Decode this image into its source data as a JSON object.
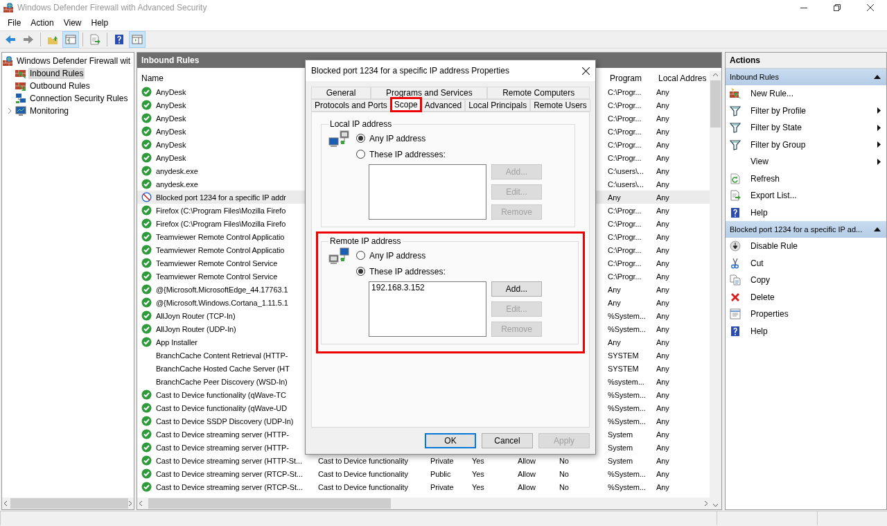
{
  "window": {
    "title": "Windows Defender Firewall with Advanced Security"
  },
  "menu": [
    "File",
    "Action",
    "View",
    "Help"
  ],
  "toolbar": [
    {
      "kind": "back",
      "pressed": false
    },
    {
      "kind": "forward",
      "pressed": false
    },
    {
      "kind": "separator"
    },
    {
      "kind": "up",
      "pressed": false
    },
    {
      "kind": "tree",
      "pressed": true
    },
    {
      "kind": "separator"
    },
    {
      "kind": "export",
      "pressed": false
    },
    {
      "kind": "separator"
    },
    {
      "kind": "help",
      "pressed": false
    },
    {
      "kind": "actionpane",
      "pressed": true
    }
  ],
  "tree": [
    {
      "label": "Windows Defender Firewall wit",
      "kind": "firewall",
      "selected": false,
      "children": [
        {
          "label": "Inbound Rules",
          "kind": "inbound",
          "selected": true
        },
        {
          "label": "Outbound Rules",
          "kind": "outbound",
          "selected": false
        },
        {
          "label": "Connection Security Rules",
          "kind": "connsec",
          "selected": false
        },
        {
          "label": "Monitoring",
          "kind": "monitor",
          "selected": false,
          "expanded": false
        }
      ]
    }
  ],
  "rules_pane": {
    "title": "Inbound Rules",
    "columns": {
      "name": "Name",
      "program": "Program",
      "local_address": "Local Addres"
    },
    "rows": [
      {
        "kind": "allow",
        "selected": false,
        "name": "AnyDesk",
        "program": "C:\\Progr...",
        "local_address": "Any"
      },
      {
        "kind": "allow",
        "selected": false,
        "name": "AnyDesk",
        "program": "C:\\Progr...",
        "local_address": "Any"
      },
      {
        "kind": "allow",
        "selected": false,
        "name": "AnyDesk",
        "program": "C:\\Progr...",
        "local_address": "Any"
      },
      {
        "kind": "allow",
        "selected": false,
        "name": "AnyDesk",
        "program": "C:\\Progr...",
        "local_address": "Any"
      },
      {
        "kind": "allow",
        "selected": false,
        "name": "AnyDesk",
        "program": "C:\\Progr...",
        "local_address": "Any"
      },
      {
        "kind": "allow",
        "selected": false,
        "name": "AnyDesk",
        "program": "C:\\Progr...",
        "local_address": "Any"
      },
      {
        "kind": "allow",
        "selected": false,
        "name": "anydesk.exe",
        "program": "C:\\users\\...",
        "local_address": "Any"
      },
      {
        "kind": "allow",
        "selected": false,
        "name": "anydesk.exe",
        "program": "C:\\users\\...",
        "local_address": "Any"
      },
      {
        "kind": "block",
        "selected": true,
        "name": "Blocked port 1234 for a specific IP addr",
        "program": "Any",
        "local_address": "Any"
      },
      {
        "kind": "allow",
        "selected": false,
        "name": "Firefox (C:\\Program Files\\Mozilla Firefo",
        "program": "C:\\Progr...",
        "local_address": "Any"
      },
      {
        "kind": "allow",
        "selected": false,
        "name": "Firefox (C:\\Program Files\\Mozilla Firefo",
        "program": "C:\\Progr...",
        "local_address": "Any"
      },
      {
        "kind": "allow",
        "selected": false,
        "name": "Teamviewer Remote Control Applicatio",
        "program": "C:\\Progr...",
        "local_address": "Any"
      },
      {
        "kind": "allow",
        "selected": false,
        "name": "Teamviewer Remote Control Applicatio",
        "program": "C:\\Progr...",
        "local_address": "Any"
      },
      {
        "kind": "allow",
        "selected": false,
        "name": "Teamviewer Remote Control Service",
        "program": "C:\\Progr...",
        "local_address": "Any"
      },
      {
        "kind": "allow",
        "selected": false,
        "name": "Teamviewer Remote Control Service",
        "program": "C:\\Progr...",
        "local_address": "Any"
      },
      {
        "kind": "allow",
        "selected": false,
        "name": "@{Microsoft.MicrosoftEdge_44.17763.1",
        "program": "Any",
        "local_address": "Any"
      },
      {
        "kind": "allow",
        "selected": false,
        "name": "@{Microsoft.Windows.Cortana_1.11.5.1",
        "program": "Any",
        "local_address": "Any"
      },
      {
        "kind": "allow",
        "selected": false,
        "name": "AllJoyn Router (TCP-In)",
        "program": "%System...",
        "local_address": "Any"
      },
      {
        "kind": "allow",
        "selected": false,
        "name": "AllJoyn Router (UDP-In)",
        "program": "%System...",
        "local_address": "Any"
      },
      {
        "kind": "allow",
        "selected": false,
        "name": "App Installer",
        "program": "Any",
        "local_address": "Any"
      },
      {
        "kind": "disabled",
        "selected": false,
        "name": "BranchCache Content Retrieval (HTTP-",
        "program": "SYSTEM",
        "local_address": "Any"
      },
      {
        "kind": "disabled",
        "selected": false,
        "name": "BranchCache Hosted Cache Server (HT",
        "program": "SYSTEM",
        "local_address": "Any"
      },
      {
        "kind": "disabled",
        "selected": false,
        "name": "BranchCache Peer Discovery (WSD-In)",
        "program": "%system...",
        "local_address": "Any"
      },
      {
        "kind": "allow",
        "selected": false,
        "name": "Cast to Device functionality (qWave-TC",
        "program": "%System...",
        "local_address": "Any"
      },
      {
        "kind": "allow",
        "selected": false,
        "name": "Cast to Device functionality (qWave-UD",
        "program": "%System...",
        "local_address": "Any"
      },
      {
        "kind": "allow",
        "selected": false,
        "name": "Cast to Device SSDP Discovery (UDP-In)",
        "program": "%System...",
        "local_address": "Any"
      },
      {
        "kind": "allow",
        "selected": false,
        "name": "Cast to Device streaming server (HTTP-",
        "program": "System",
        "local_address": "Any"
      },
      {
        "kind": "allow",
        "selected": false,
        "name": "Cast to Device streaming server (HTTP-",
        "program": "System",
        "local_address": "Any"
      },
      {
        "kind": "allow",
        "selected": false,
        "name": "Cast to Device streaming server (HTTP-St...",
        "column_2": "Cast to Device functionality",
        "column_3": "Private",
        "column_4": "Yes",
        "column_5": "Allow",
        "column_6": "No",
        "program": "System",
        "local_address": "Any"
      },
      {
        "kind": "allow",
        "selected": false,
        "name": "Cast to Device streaming server (RTCP-St...",
        "column_2": "Cast to Device functionality",
        "column_3": "Public",
        "column_4": "Yes",
        "column_5": "Allow",
        "column_6": "No",
        "program": "%System...",
        "local_address": "Any"
      },
      {
        "kind": "allow",
        "selected": false,
        "name": "Cast to Device streaming server (RTCP-St...",
        "column_2": "Cast to Device functionality",
        "column_3": "Private",
        "column_4": "Yes",
        "column_5": "Allow",
        "column_6": "No",
        "program": "%System...",
        "local_address": "Any"
      }
    ]
  },
  "actions": {
    "title": "Actions",
    "sections": [
      {
        "title": "Inbound Rules",
        "expanded": true,
        "items": [
          {
            "label": "New Rule...",
            "kind": "new_rule",
            "submenu": false
          },
          {
            "label": "Filter by Profile",
            "kind": "filter",
            "submenu": true
          },
          {
            "label": "Filter by State",
            "kind": "filter",
            "submenu": true
          },
          {
            "label": "Filter by Group",
            "kind": "filter",
            "submenu": true
          },
          {
            "label": "View",
            "kind": "none",
            "submenu": true
          },
          {
            "label": "Refresh",
            "kind": "refresh",
            "submenu": false
          },
          {
            "label": "Export List...",
            "kind": "export",
            "submenu": false
          },
          {
            "label": "Help",
            "kind": "help",
            "submenu": false
          }
        ]
      },
      {
        "title": "Blocked port 1234 for a specific IP ad...",
        "expanded": true,
        "items": [
          {
            "label": "Disable Rule",
            "kind": "disable",
            "submenu": false
          },
          {
            "label": "Cut",
            "kind": "cut",
            "submenu": false
          },
          {
            "label": "Copy",
            "kind": "copy",
            "submenu": false
          },
          {
            "label": "Delete",
            "kind": "delete",
            "submenu": false
          },
          {
            "label": "Properties",
            "kind": "properties",
            "submenu": false
          },
          {
            "label": "Help",
            "kind": "help",
            "submenu": false
          }
        ]
      }
    ]
  },
  "dialog": {
    "title": "Blocked port 1234 for a specific IP address Properties",
    "tab_rows": [
      [
        {
          "label": "General",
          "selected": false,
          "highlighted": false
        },
        {
          "label": "Programs and Services",
          "selected": false,
          "highlighted": false
        },
        {
          "label": "Remote Computers",
          "selected": false,
          "highlighted": false
        }
      ],
      [
        {
          "label": "Protocols and Ports",
          "selected": false,
          "highlighted": false
        },
        {
          "label": "Scope",
          "selected": true,
          "highlighted": true
        },
        {
          "label": "Advanced",
          "selected": false,
          "highlighted": false
        },
        {
          "label": "Local Principals",
          "selected": false,
          "highlighted": false
        },
        {
          "label": "Remote Users",
          "selected": false,
          "highlighted": false
        }
      ]
    ],
    "groups": [
      {
        "title": "Local IP address",
        "highlighted": false,
        "options": [
          {
            "label": "Any IP address",
            "selected": true
          },
          {
            "label": "These IP addresses:",
            "selected": false
          }
        ],
        "buttons": [
          {
            "label": "Add...",
            "disabled": true
          },
          {
            "label": "Edit...",
            "disabled": true
          },
          {
            "label": "Remove",
            "disabled": true
          }
        ]
      },
      {
        "title": "Remote IP address",
        "highlighted": true,
        "options": [
          {
            "label": "Any IP address",
            "selected": false
          },
          {
            "label": "These IP addresses:",
            "selected": true
          }
        ],
        "addresses": [
          "192.168.3.152"
        ],
        "buttons": [
          {
            "label": "Add...",
            "disabled": false
          },
          {
            "label": "Edit...",
            "disabled": true
          },
          {
            "label": "Remove",
            "disabled": true
          }
        ]
      }
    ],
    "buttons": [
      {
        "label": "OK",
        "default": true,
        "disabled": false
      },
      {
        "label": "Cancel",
        "default": false,
        "disabled": false
      },
      {
        "label": "Apply",
        "default": false,
        "disabled": true
      }
    ]
  }
}
